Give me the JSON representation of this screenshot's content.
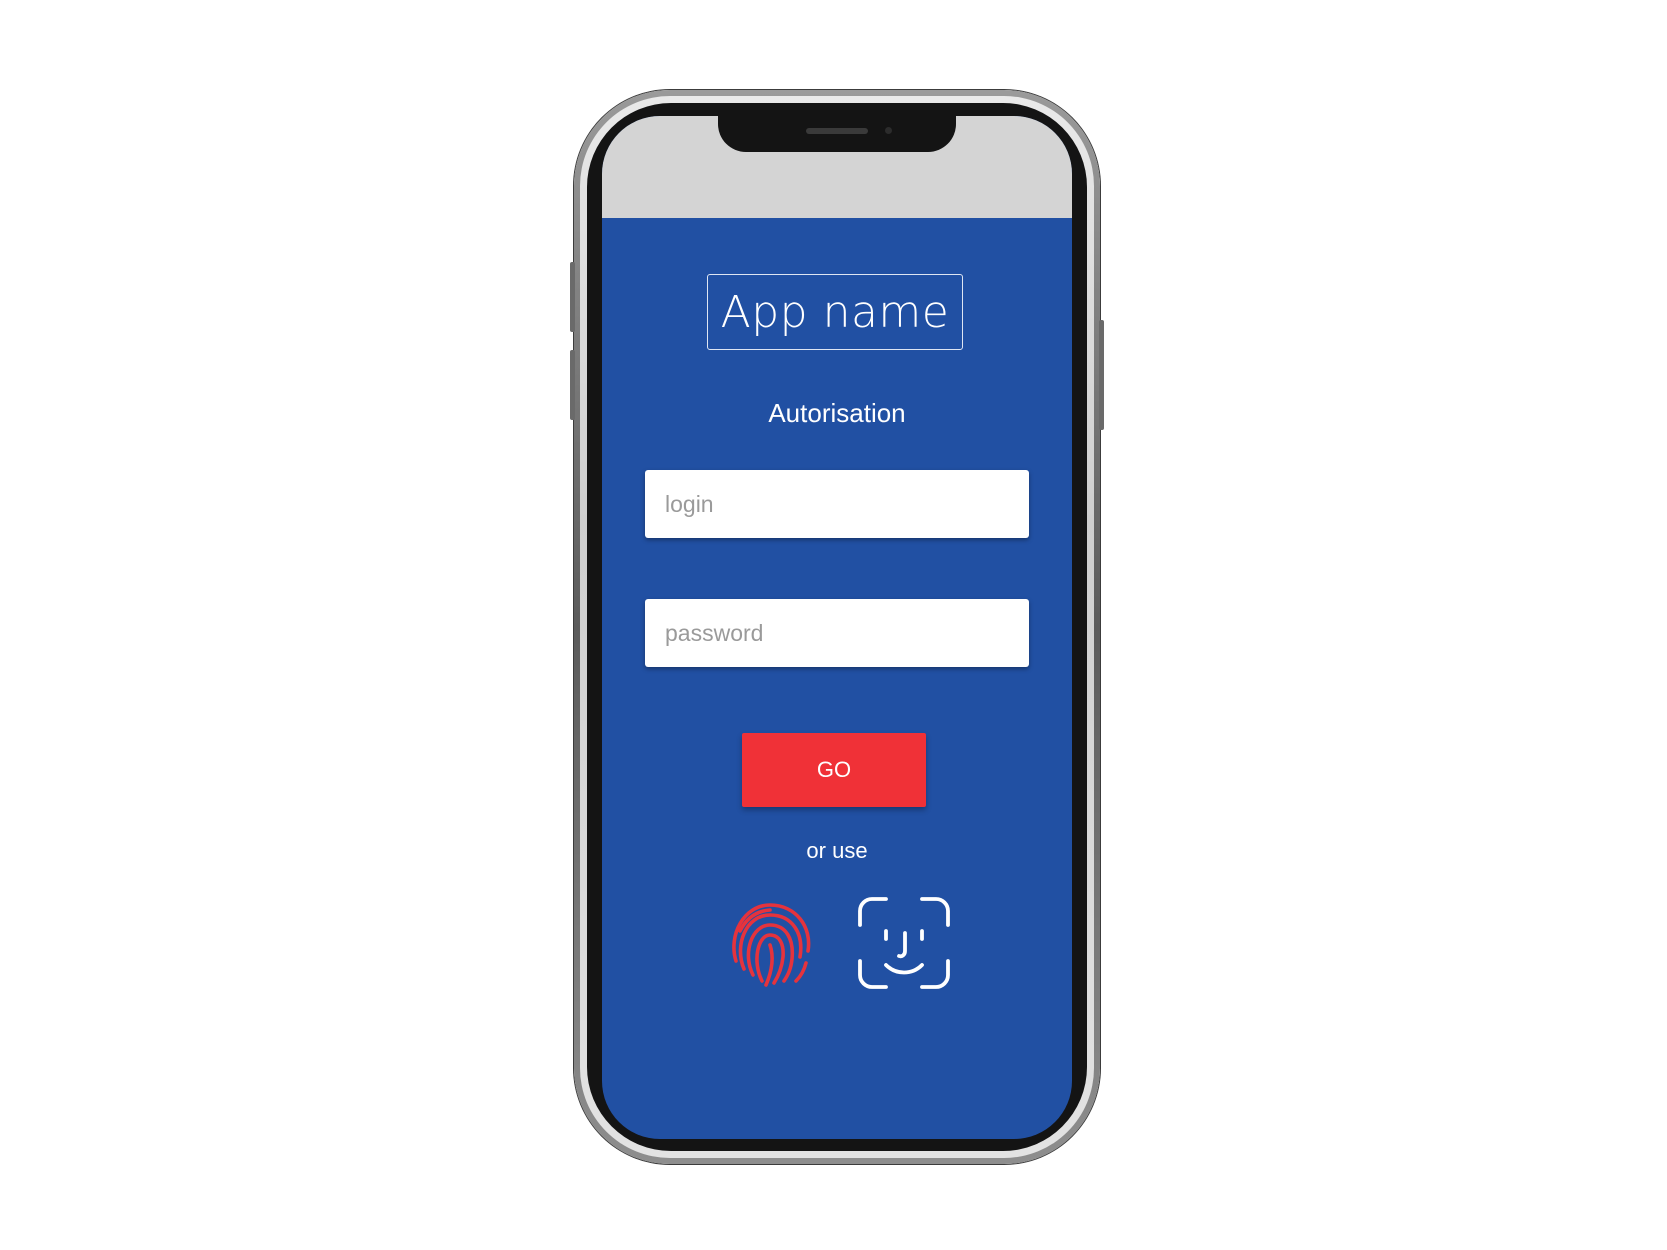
{
  "app": {
    "name": "App name",
    "subtitle": "Autorisation"
  },
  "form": {
    "login_placeholder": "login",
    "login_value": "",
    "password_placeholder": "password",
    "password_value": "",
    "submit_label": "GO"
  },
  "alt_auth": {
    "label": "or use",
    "options": [
      {
        "icon": "fingerprint-icon"
      },
      {
        "icon": "face-id-icon"
      }
    ]
  },
  "colors": {
    "screen_background": "#2150a3",
    "status_bar": "#d4d4d4",
    "accent": "#f03137",
    "fingerprint": "#e5333d",
    "face_id": "#ffffff"
  }
}
